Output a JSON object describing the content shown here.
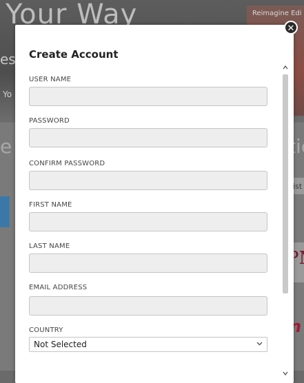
{
  "background": {
    "hero_title": "Your Way",
    "hero_sub": "es",
    "hero_you": "Yo",
    "right_card_label": "Reimagine Edi",
    "left_partial": "e",
    "right_partial": "tic",
    "right_gist": "gist",
    "right_pm": "PM",
    "right_n": "n"
  },
  "modal": {
    "title": "Create Account",
    "close_glyph": "✕",
    "fields": [
      {
        "label": "USER NAME",
        "value": ""
      },
      {
        "label": "PASSWORD",
        "value": ""
      },
      {
        "label": "CONFIRM PASSWORD",
        "value": ""
      },
      {
        "label": "FIRST NAME",
        "value": ""
      },
      {
        "label": "LAST NAME",
        "value": ""
      },
      {
        "label": "EMAIL ADDRESS",
        "value": ""
      }
    ],
    "country": {
      "label": "COUNTRY",
      "selected": "Not Selected"
    }
  },
  "icons": {
    "close": "close-icon",
    "chevron": "chevron-down-icon"
  }
}
